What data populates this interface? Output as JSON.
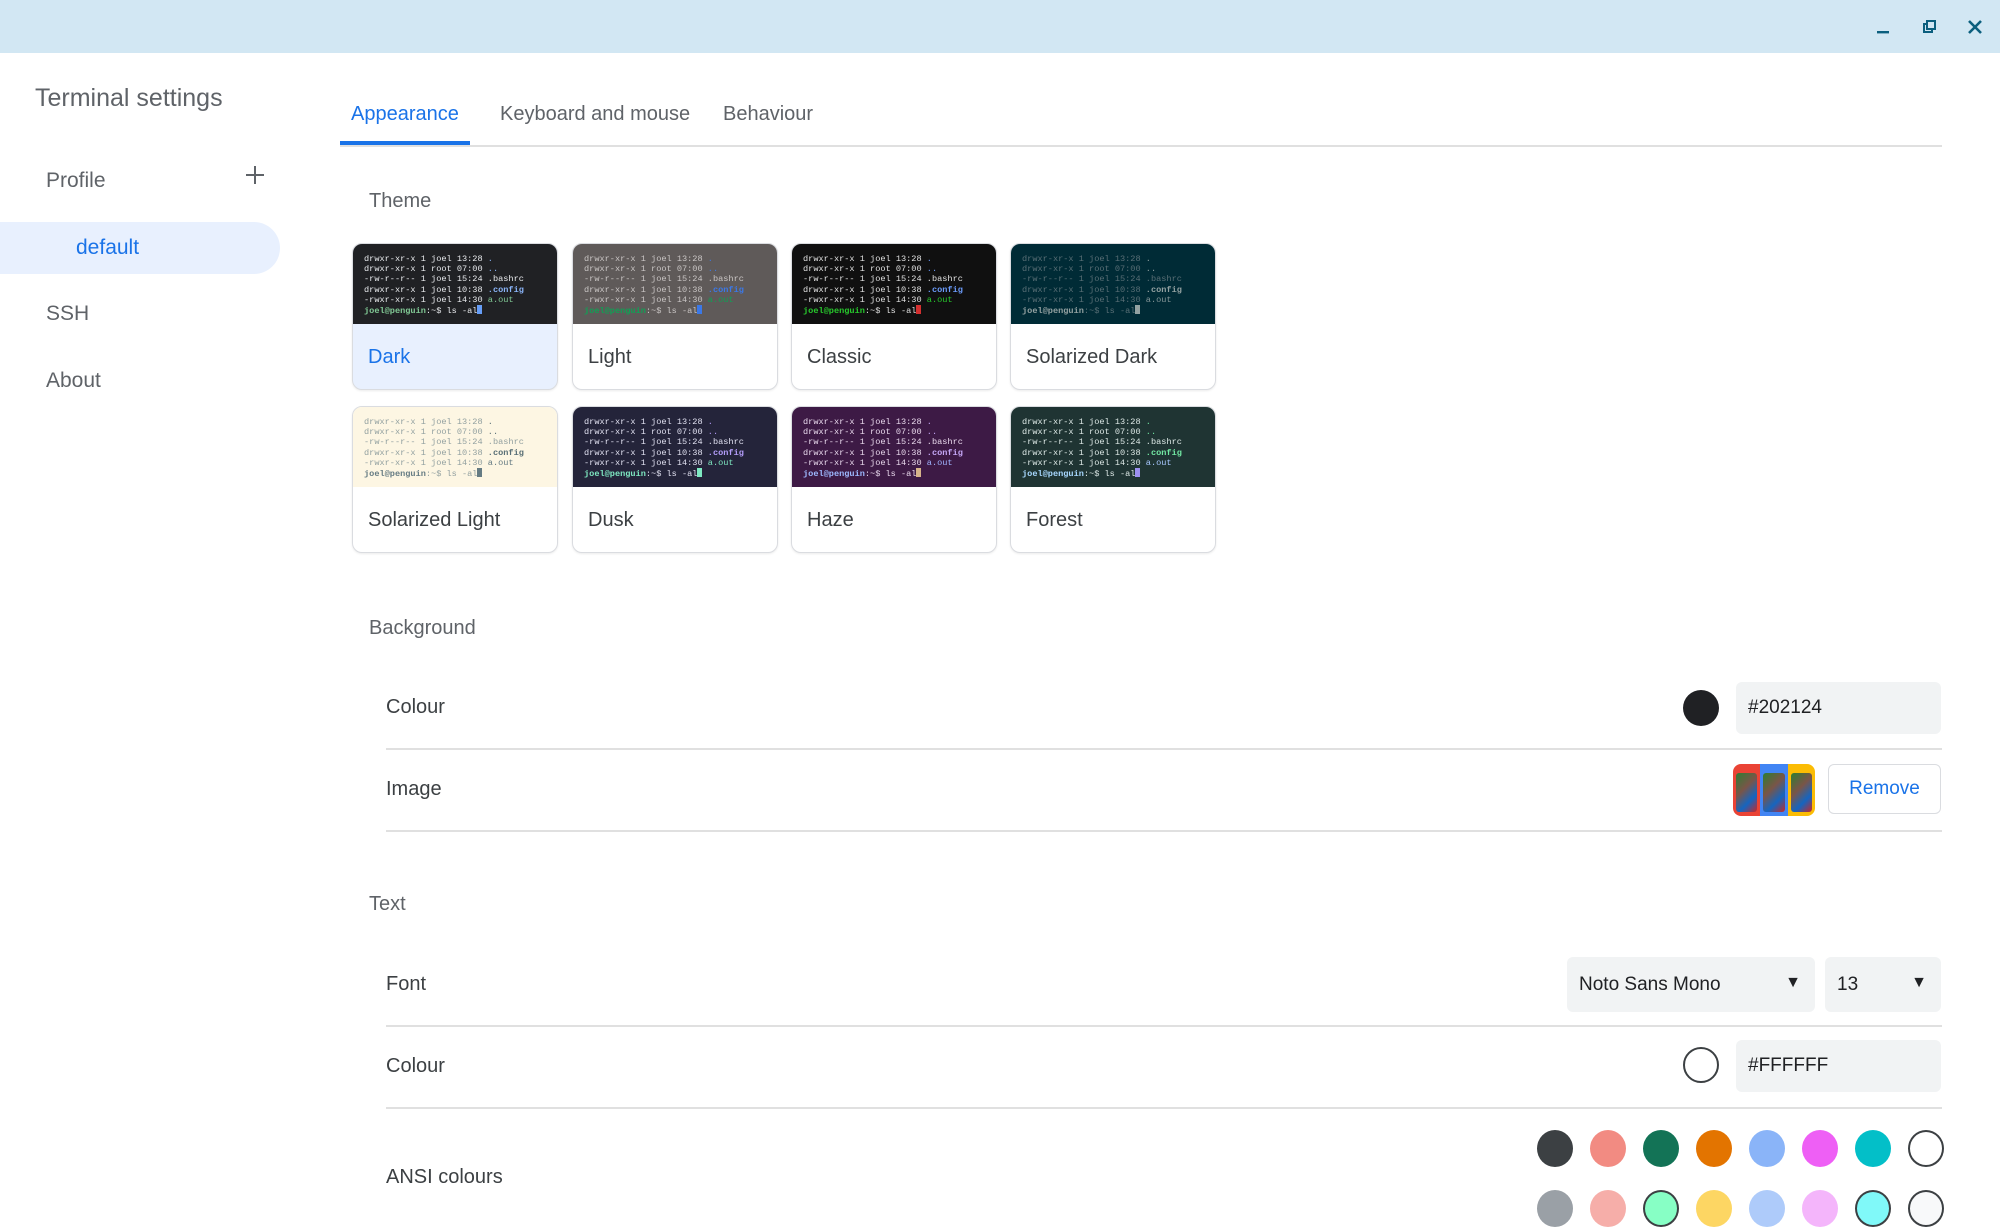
{
  "window": {
    "controls": [
      {
        "name": "minimize-button",
        "icon": "minimize-icon"
      },
      {
        "name": "restore-button",
        "icon": "restore-icon"
      },
      {
        "name": "close-button",
        "icon": "close-icon"
      }
    ]
  },
  "app_title": "Terminal settings",
  "sidebar": {
    "profile_header": "Profile",
    "add_profile_icon": "plus-icon",
    "profiles": [
      {
        "label": "default",
        "selected": true
      }
    ],
    "items": [
      {
        "label": "SSH"
      },
      {
        "label": "About"
      }
    ]
  },
  "tabs": [
    {
      "label": "Appearance",
      "active": true
    },
    {
      "label": "Keyboard and mouse",
      "active": false
    },
    {
      "label": "Behaviour",
      "active": false
    }
  ],
  "theme": {
    "heading": "Theme",
    "preview_lines": [
      {
        "perm": "drwxr-xr-x 1 joel 13:28 ",
        "name": "."
      },
      {
        "perm": "drwxr-xr-x 1 root 07:00 ",
        "name": ".."
      },
      {
        "perm": "-rw-r--r-- 1 joel 15:24 ",
        "name": ".bashrc"
      },
      {
        "perm": "drwxr-xr-x 1 joel 10:38 ",
        "name": ".config"
      },
      {
        "perm": "-rwxr-xr-x 1 joel 14:30 ",
        "name": "a.out"
      }
    ],
    "prompt_user": "joel@penguin",
    "prompt_rest": ":~$ ls -al",
    "cards": [
      {
        "label": "Dark",
        "selected": true,
        "bg": "#202124",
        "fg": "#e8eaed",
        "dir": "#8ab4f8",
        "exe": "#81c995",
        "user": "#81c995",
        "cursor": "#669df6"
      },
      {
        "label": "Light",
        "selected": false,
        "bg": "#5f5a59",
        "fg": "#c9c5c4",
        "dir": "#3b78e7",
        "exe": "#11a055",
        "user": "#11a055",
        "cursor": "#3b78e7"
      },
      {
        "label": "Classic",
        "selected": false,
        "bg": "#101010",
        "fg": "#e0e0e0",
        "dir": "#6b9bfa",
        "exe": "#27c92c",
        "user": "#27c92c",
        "cursor": "#d32f2f"
      },
      {
        "label": "Solarized Dark",
        "selected": false,
        "bg": "#002b36",
        "fg": "#586e75",
        "dir": "#93a1a1",
        "exe": "#839496",
        "user": "#93a1a1",
        "cursor": "#93a1a1"
      },
      {
        "label": "Solarized Light",
        "selected": false,
        "bg": "#fdf6e3",
        "fg": "#93a1a1",
        "dir": "#586e75",
        "exe": "#657b83",
        "user": "#657b83",
        "cursor": "#657b83"
      },
      {
        "label": "Dusk",
        "selected": false,
        "bg": "#24243a",
        "fg": "#e0e0f0",
        "dir": "#b49dfa",
        "exe": "#7ee8c1",
        "user": "#7ee8c1",
        "cursor": "#7ee8c1"
      },
      {
        "label": "Haze",
        "selected": false,
        "bg": "#3d1a45",
        "fg": "#e8d8ec",
        "dir": "#c4a6f5",
        "exe": "#a0b4ff",
        "user": "#9db9ff",
        "cursor": "#d6b48a"
      },
      {
        "label": "Forest",
        "selected": false,
        "bg": "#1f3433",
        "fg": "#dde8e6",
        "dir": "#72e8a3",
        "exe": "#a8c8ff",
        "user": "#a8d8ff",
        "cursor": "#9c8ff0"
      }
    ]
  },
  "background": {
    "heading": "Background",
    "colour_label": "Colour",
    "colour_value": "#202124",
    "image_label": "Image",
    "remove_label": "Remove",
    "thumb_colors": [
      "#ea4335",
      "#4285f4",
      "#fbbc04"
    ]
  },
  "text": {
    "heading": "Text",
    "font_label": "Font",
    "font_value": "Noto Sans Mono",
    "size_value": "13",
    "dropdown_icon": "triangle-down-icon",
    "colour_label": "Colour",
    "colour_value": "#FFFFFF",
    "ansi_label": "ANSI colours",
    "ansi_normal": [
      "#3c4043",
      "#f28b82",
      "#137356",
      "#e37400",
      "#8ab4f8",
      "#ee5ff5",
      "#03bfc8",
      "#ffffff"
    ],
    "ansi_bright": [
      "#9aa0a6",
      "#f6aea9",
      "#87ffc5",
      "#fdd663",
      "#aecbfa",
      "#f4b5fb",
      "#80f9f9",
      "#f8f9fa"
    ]
  }
}
